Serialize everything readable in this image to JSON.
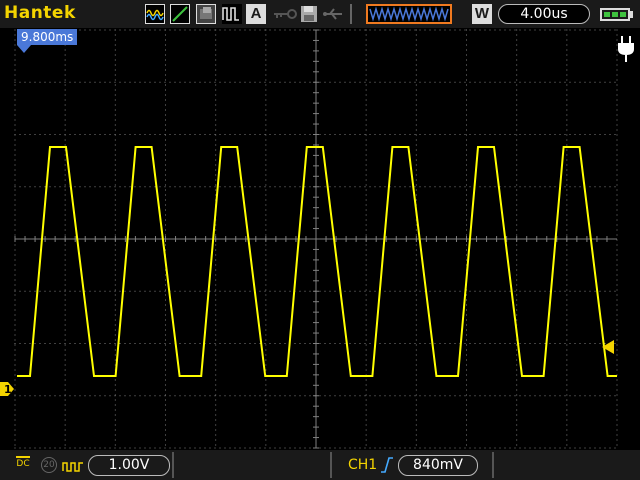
{
  "brand": "Hantek",
  "top_bar": {
    "icons": [
      "waveform-mode-icon",
      "slope-icon",
      "persistence-icon",
      "pulse-icon",
      "auto-icon",
      "key-icon",
      "save-icon",
      "usb-icon"
    ],
    "auto_label": "A",
    "acquire_label": "W",
    "timebase": "4.00us"
  },
  "scope": {
    "trigger_time": "9.800ms",
    "channel_label": "1",
    "trace_color": "#ffff00",
    "grid_color": "#808080"
  },
  "bottom_bar": {
    "coupling": "DC",
    "bandwidth_limit": "20",
    "volts_per_div": "1.00V",
    "trigger_source": "CH1",
    "trigger_level": "840mV"
  },
  "colors": {
    "accent": "#f4d400",
    "trigger_blue": "#4a78d8",
    "memory_bar": "#f07a20",
    "battery": "#3ec23e"
  }
}
